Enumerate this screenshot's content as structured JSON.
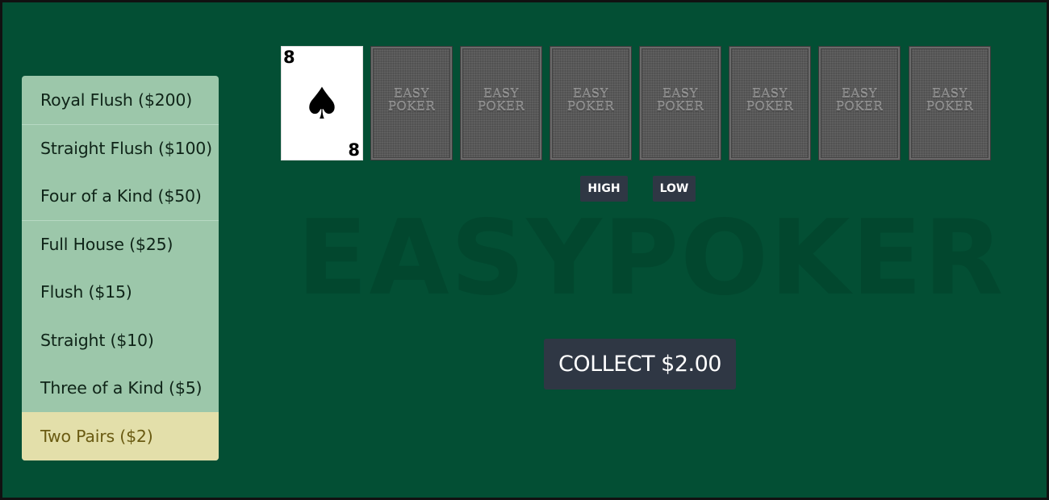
{
  "paytable": [
    {
      "label": "Royal Flush ($200)",
      "active": false
    },
    {
      "label": "Straight Flush ($100)",
      "active": false
    },
    {
      "label": "Four of a Kind ($50)",
      "active": false
    },
    {
      "label": "Full House ($25)",
      "active": false
    },
    {
      "label": "Flush ($15)",
      "active": false
    },
    {
      "label": "Straight ($10)",
      "active": false
    },
    {
      "label": "Three of a Kind ($5)",
      "active": false
    },
    {
      "label": "Two Pairs ($2)",
      "active": true
    }
  ],
  "watermark": "EASYPOKER",
  "cards": {
    "face_card": {
      "rank": "8",
      "suit": "♠",
      "suit_name": "spade-icon"
    },
    "back_logo_line1": "EASY",
    "back_logo_line2": "POKER"
  },
  "buttons": {
    "high": "HIGH",
    "low": "LOW",
    "collect": "COLLECT $2.00"
  },
  "colors": {
    "table": "#034f34",
    "paytable": "#9cc7aa",
    "paytable_active": "#e3dfaa",
    "button": "#2f3744"
  }
}
